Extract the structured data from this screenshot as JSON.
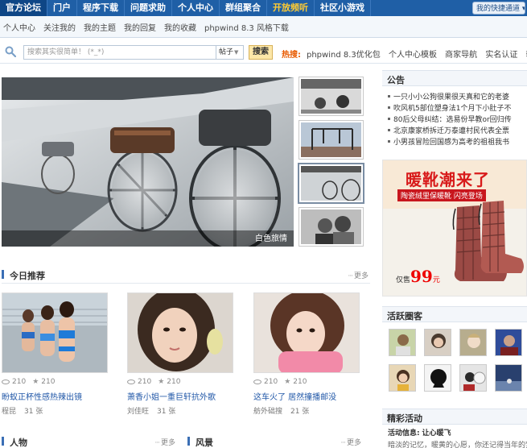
{
  "topnav": {
    "items": [
      "官方论坛",
      "门户",
      "程序下载",
      "问题求助",
      "个人中心",
      "群组聚合",
      "开放频听",
      "社区小游戏"
    ],
    "quick_link": "我的快捷通道"
  },
  "subnav": {
    "items": [
      "个人中心",
      "关注我的",
      "我的主题",
      "我的回复",
      "我的收藏",
      "phpwind 8.3 风格下载"
    ]
  },
  "search": {
    "placeholder": "搜索其实很简单！ (*_*)",
    "scope": "帖子",
    "button": "搜索",
    "hot_label": "热搜:",
    "hot_links": [
      "phpwind 8.3优化包",
      "个人中心模板",
      "商家导航",
      "实名认证",
      "转"
    ]
  },
  "slider": {
    "caption": "白色旅情"
  },
  "recommend": {
    "title": "今日推荐",
    "more": "更多",
    "cards": [
      {
        "views": "210",
        "stars": "210",
        "title": "盼蚁正杯性感热辣出镜",
        "author": "程昆",
        "count": "31 张"
      },
      {
        "views": "210",
        "stars": "210",
        "title": "萧香小姐一重巨轩抗外歌",
        "author": "刘佳旺",
        "count": "31 张"
      },
      {
        "views": "210",
        "stars": "210",
        "title": "这车火了 居然撞播邮没",
        "author": "舫外础搜",
        "count": "21 张"
      }
    ]
  },
  "sections": {
    "people": {
      "title": "人物",
      "more": "更多"
    },
    "scenery": {
      "title": "风景",
      "more": "更多"
    }
  },
  "notice": {
    "title": "公告",
    "items": [
      "一只小小公狗很果很天真和它的老婆",
      "吹风机5部位塑身法1个月下小肚子不",
      "80后父母纠结：选易份早教or回归传",
      "北京康家桥拆迁万泰遭村民代表全票",
      "小男孩冒险回国感为高考的祖祖我书"
    ]
  },
  "ad": {
    "title": "暖靴潮来了",
    "subtitle": "陶瓷绒里保暖靴 闪亮登场",
    "price_prefix": "仅售",
    "price": "99",
    "price_unit": "元"
  },
  "active_circle": {
    "title": "活跃圈客"
  },
  "events": {
    "title": "精彩活动",
    "label": "活动信息:",
    "name": "让心暖飞",
    "desc": "暗淡的记忆，暖黄的心愿，你还记得当年的梦"
  }
}
